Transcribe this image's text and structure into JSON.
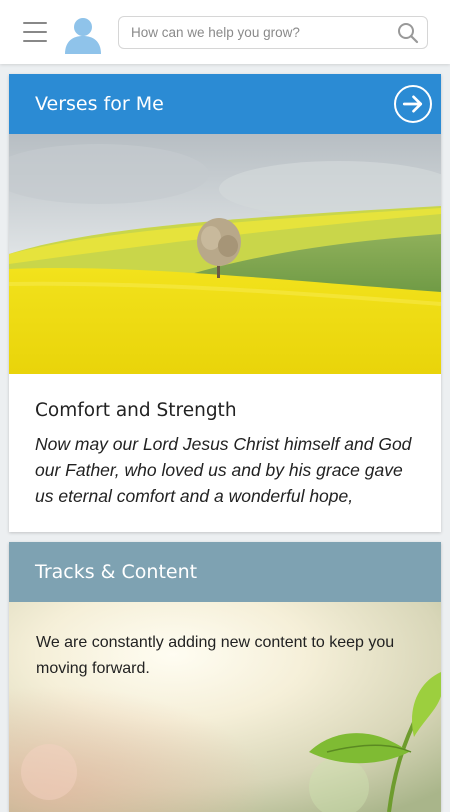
{
  "header": {
    "search_placeholder": "How can we help you grow?",
    "menu_icon": "hamburger-menu-icon",
    "avatar_icon": "user-avatar-icon",
    "search_icon": "magnifier-icon"
  },
  "verses_card": {
    "title": "Verses for Me",
    "header_color": "#2b8bd4",
    "arrow_icon": "arrow-right-circle-icon",
    "image": "yellow-field-tree-photo",
    "verse_title": "Comfort and Strength",
    "verse_text": "Now may our Lord Jesus Christ himself and God our Father, who loved us and by his grace gave us eternal comfort and a wonderful hope, comfort…"
  },
  "tracks_card": {
    "title": "Tracks & Content",
    "header_color": "#7ea2b2",
    "description": "We are constantly adding new content to keep you moving forward.",
    "image": "sprout-sunlight-photo"
  }
}
